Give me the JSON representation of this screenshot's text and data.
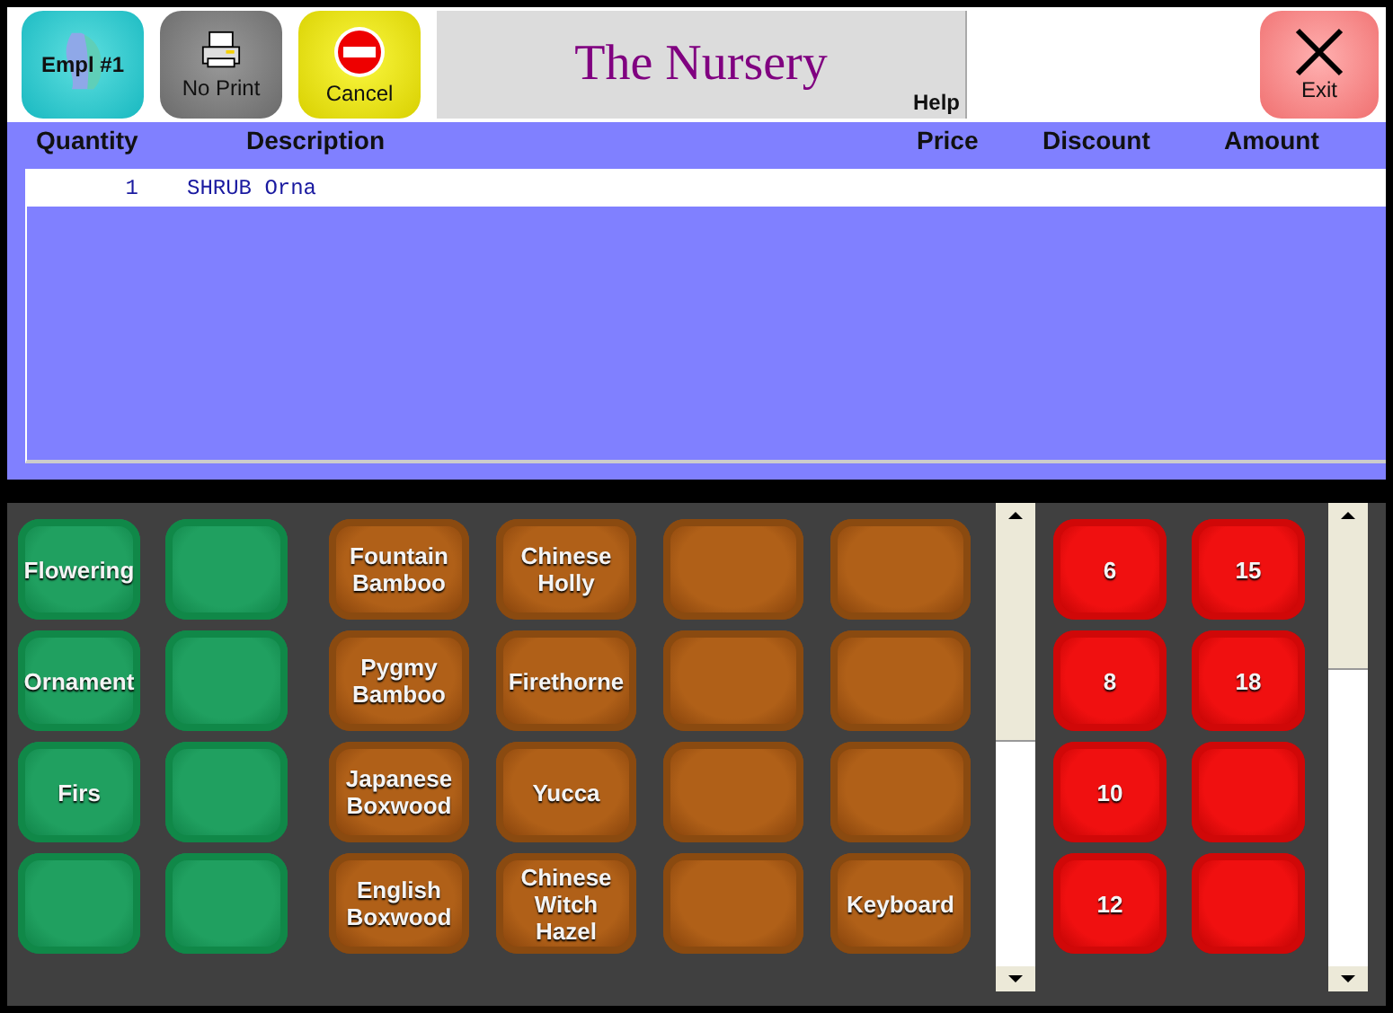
{
  "toolbar": {
    "buttons": [
      {
        "kind": "employee",
        "label": "Empl #1"
      },
      {
        "kind": "print",
        "label": "No Print"
      },
      {
        "kind": "cancel",
        "label": "Cancel"
      }
    ],
    "title": "The Nursery",
    "help": "Help",
    "exit": "Exit"
  },
  "table": {
    "columns": [
      "Quantity",
      "Description",
      "Price",
      "Discount",
      "Amount"
    ],
    "rows": [
      {
        "quantity": "1",
        "description": "SHRUB Orna"
      }
    ]
  },
  "panels": [
    {
      "kind": "category",
      "buttons": [
        {
          "kind": "key",
          "label": "Flowering"
        },
        {
          "kind": "blank"
        },
        {
          "kind": "key",
          "label": "Ornament"
        },
        {
          "kind": "blank"
        },
        {
          "kind": "key",
          "label": "Firs"
        },
        {
          "kind": "blank"
        },
        {
          "kind": "blank"
        },
        {
          "kind": "blank"
        }
      ]
    },
    {
      "kind": "item",
      "buttons": [
        {
          "kind": "key",
          "label": "Fountain Bamboo"
        },
        {
          "kind": "key",
          "label": "Chinese Holly"
        },
        {
          "kind": "blank"
        },
        {
          "kind": "blank"
        },
        {
          "kind": "key",
          "label": "Pygmy Bamboo"
        },
        {
          "kind": "key",
          "label": "Firethorne"
        },
        {
          "kind": "blank"
        },
        {
          "kind": "blank"
        },
        {
          "kind": "key",
          "label": "Japanese Boxwood"
        },
        {
          "kind": "key",
          "label": "Yucca"
        },
        {
          "kind": "blank"
        },
        {
          "kind": "blank"
        },
        {
          "kind": "key",
          "label": "English Boxwood"
        },
        {
          "kind": "key",
          "label": "Chinese Witch Hazel"
        },
        {
          "kind": "blank"
        },
        {
          "kind": "key",
          "label": "Keyboard"
        }
      ]
    },
    {
      "kind": "number",
      "buttons": [
        {
          "kind": "key",
          "label": "6"
        },
        {
          "kind": "key",
          "label": "15"
        },
        {
          "kind": "key",
          "label": "8"
        },
        {
          "kind": "key",
          "label": "18"
        },
        {
          "kind": "key",
          "label": "10"
        },
        {
          "kind": "blank"
        },
        {
          "kind": "key",
          "label": "12"
        },
        {
          "kind": "blank"
        }
      ]
    }
  ]
}
